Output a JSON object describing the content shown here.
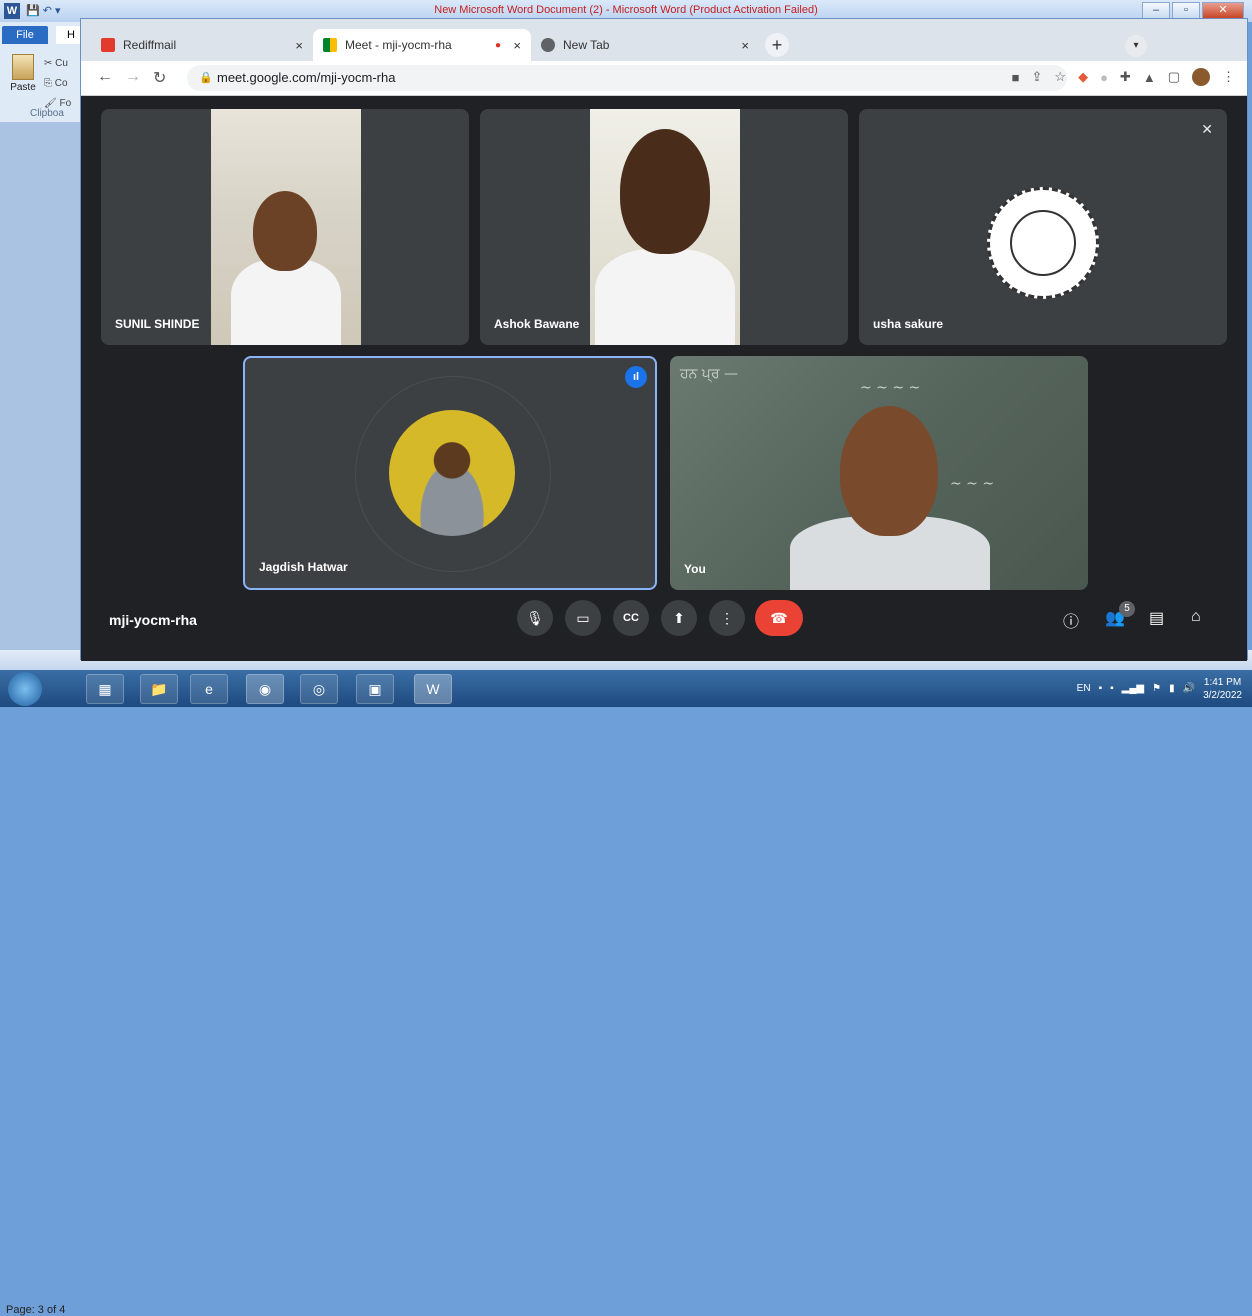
{
  "word": {
    "title": "New Microsoft Word Document (2)  -  Microsoft Word (Product Activation Failed)",
    "file_tab": "File",
    "home_tab": "H",
    "paste_label": "Paste",
    "clip_items": [
      "Cu",
      "Co",
      "Fo"
    ],
    "clipboard_label": "Clipboa",
    "page_status": "Page: 3 of 4"
  },
  "browser": {
    "tabs": [
      {
        "label": "Rediffmail",
        "close": "×"
      },
      {
        "label": "Meet - mji-yocm-rha",
        "close": "×"
      },
      {
        "label": "New Tab",
        "close": "×"
      }
    ],
    "new_tab": "+",
    "url": "meet.google.com/mji-yocm-rha"
  },
  "meet": {
    "participants": [
      {
        "name": "SUNIL SHINDE"
      },
      {
        "name": "Ashok Bawane"
      },
      {
        "name": "usha sakure"
      },
      {
        "name": "Jagdish Hatwar"
      },
      {
        "name": "You"
      }
    ],
    "meeting_code": "mji-yocm-rha",
    "people_count": "5"
  },
  "taskbar": {
    "lang": "EN",
    "time": "1:41 PM",
    "date": "3/2/2022"
  },
  "colors": {
    "accent": "#1a73e8",
    "end_call": "#ea4335",
    "meet_bg": "#202124",
    "tile_bg": "#3c4043"
  }
}
